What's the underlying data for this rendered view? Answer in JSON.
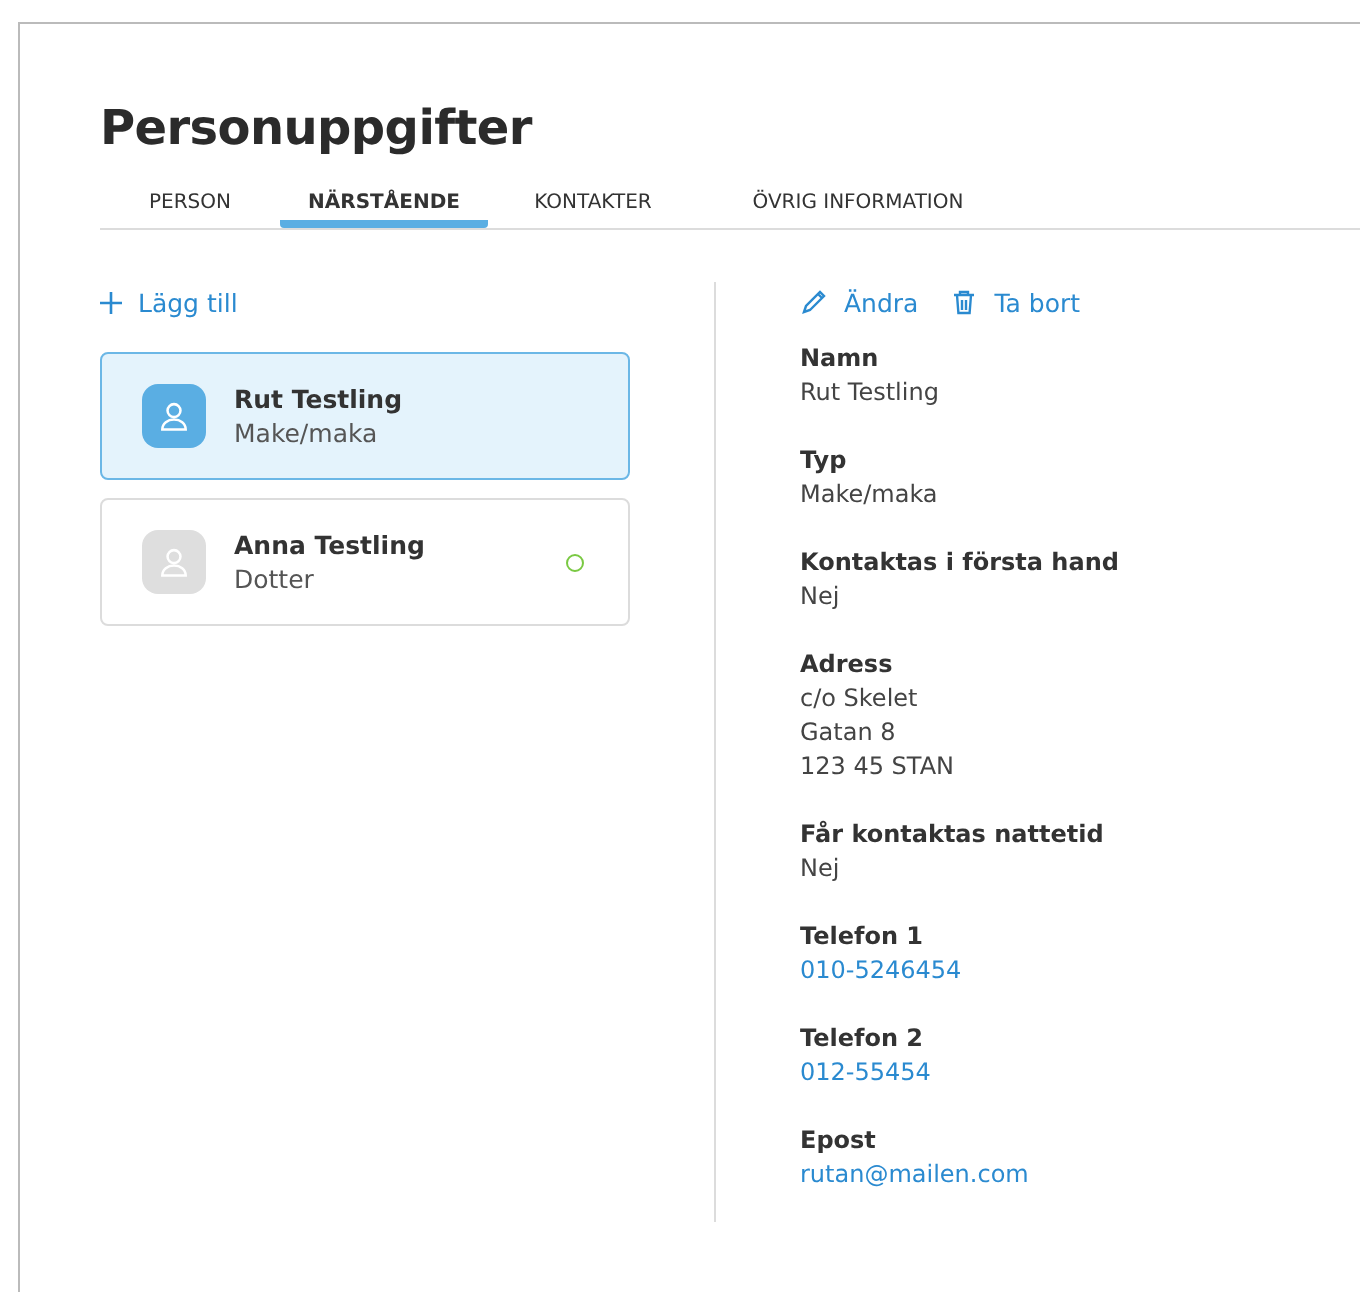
{
  "page": {
    "title": "Personuppgifter"
  },
  "tabs": [
    {
      "label": "PERSON",
      "selected": false
    },
    {
      "label": "NÄRSTÅENDE",
      "selected": true
    },
    {
      "label": "KONTAKTER",
      "selected": false
    },
    {
      "label": "ÖVRIG INFORMATION",
      "selected": false
    }
  ],
  "add_button": {
    "label": "Lägg till"
  },
  "relatives": [
    {
      "name": "Rut Testling",
      "relation": "Make/maka",
      "selected": true
    },
    {
      "name": "Anna Testling",
      "relation": "Dotter",
      "selected": false,
      "color": "#7ac943"
    }
  ],
  "actions": [
    {
      "kind": "edit",
      "label": "Ändra"
    },
    {
      "kind": "delete",
      "label": "Ta bort"
    }
  ],
  "details": [
    {
      "label": "Namn",
      "kind": "text",
      "lines": [
        "Rut Testling"
      ]
    },
    {
      "label": "Typ",
      "kind": "text",
      "lines": [
        "Make/maka"
      ]
    },
    {
      "label": "Kontaktas i första hand",
      "kind": "text",
      "lines": [
        "Nej"
      ]
    },
    {
      "label": "Adress",
      "kind": "text",
      "lines": [
        "c/o Skelet",
        "Gatan 8",
        "123 45 STAN"
      ]
    },
    {
      "label": "Får kontaktas nattetid",
      "kind": "text",
      "lines": [
        "Nej"
      ]
    },
    {
      "label": "Telefon 1",
      "kind": "link",
      "lines": [
        "010-5246454"
      ]
    },
    {
      "label": "Telefon 2",
      "kind": "link",
      "lines": [
        "012-55454"
      ]
    },
    {
      "label": "Epost",
      "kind": "link",
      "lines": [
        "rutan@mailen.com"
      ]
    }
  ]
}
